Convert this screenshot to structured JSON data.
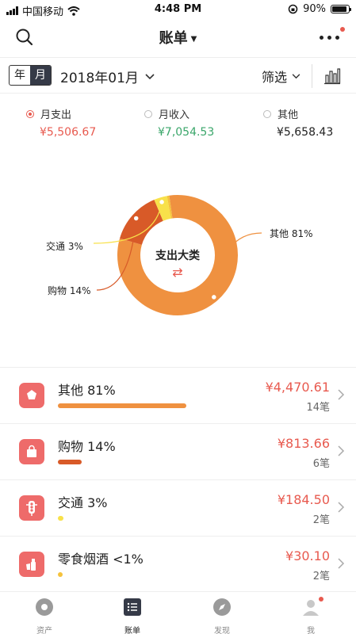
{
  "status_bar": {
    "carrier": "中国移动",
    "time": "4:48 PM",
    "battery": "90%",
    "battery_level": 0.9
  },
  "nav": {
    "title": "账单"
  },
  "toolbar": {
    "year_label": "年",
    "month_label": "月",
    "selected_month": "2018年01月",
    "filter_label": "筛选"
  },
  "summary": {
    "items": [
      {
        "label": "月支出",
        "value": "¥5,506.67",
        "selected": true
      },
      {
        "label": "月收入",
        "value": "¥7,054.53",
        "selected": false
      },
      {
        "label": "其他",
        "value": "¥5,658.43",
        "selected": false
      }
    ]
  },
  "donut": {
    "center_title": "支出大类",
    "swap_symbol": "⇄",
    "slices": [
      {
        "name": "其他",
        "pct_text": "81%",
        "pct": 81,
        "color": "#ef9140"
      },
      {
        "name": "购物",
        "pct_text": "14%",
        "pct": 14,
        "color": "#d85a28"
      },
      {
        "name": "交通",
        "pct_text": "3%",
        "pct": 3.5,
        "color": "#f8e14a"
      },
      {
        "name": "零食烟酒",
        "pct_text": "<1%",
        "pct": 0.6,
        "color": "#f5c23c"
      }
    ]
  },
  "categories": [
    {
      "name": "其他 81%",
      "amount": "¥4,470.61",
      "count": "14笔",
      "share": 0.81,
      "color": "#ef9140",
      "icon": "star-icon"
    },
    {
      "name": "购物 14%",
      "amount": "¥813.66",
      "count": "6笔",
      "share": 0.148,
      "color": "#d85a28",
      "icon": "shopping-bag-icon"
    },
    {
      "name": "交通 3%",
      "amount": "¥184.50",
      "count": "2笔",
      "share": 0.033,
      "color": "#f8e14a",
      "icon": "traffic-light-icon"
    },
    {
      "name": "零食烟酒 <1%",
      "amount": "¥30.10",
      "count": "2笔",
      "share": 0.005,
      "color": "#f5c23c",
      "icon": "snack-icon"
    }
  ],
  "tabs": [
    {
      "label": "资产",
      "icon": "asset-icon",
      "active": false
    },
    {
      "label": "账单",
      "icon": "bill-list-icon",
      "active": true
    },
    {
      "label": "发现",
      "icon": "compass-icon",
      "active": false
    },
    {
      "label": "我",
      "icon": "profile-icon",
      "active": false
    }
  ],
  "colors": {
    "accent_red": "#e85a4f",
    "income_green": "#3aa66a",
    "icon_bg": "#ee6b6a",
    "dark": "#353a47"
  }
}
